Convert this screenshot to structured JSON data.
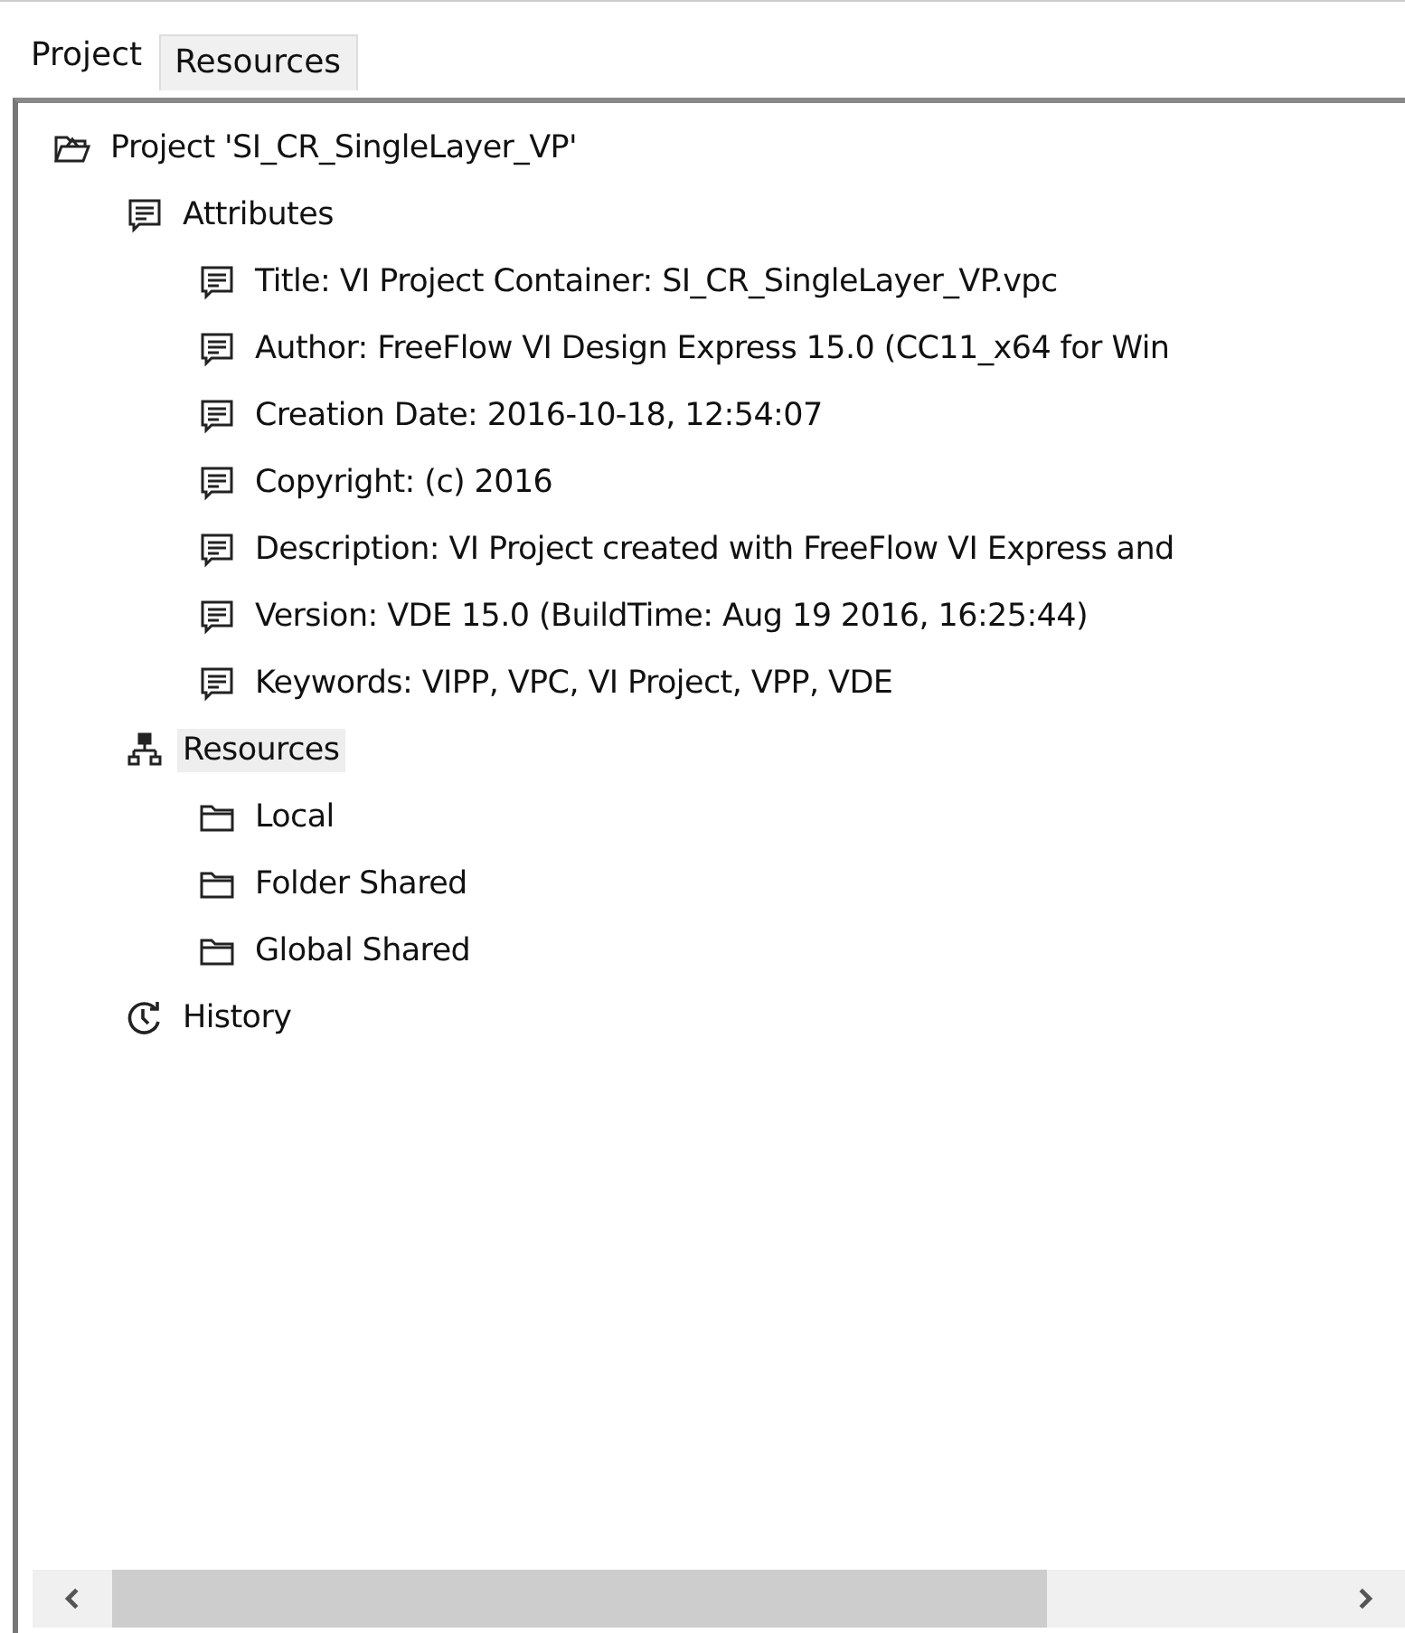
{
  "tabs": [
    {
      "label": "Project",
      "selected": true
    },
    {
      "label": "Resources",
      "selected": false
    }
  ],
  "tree": [
    {
      "label": "Project 'SI_CR_SingleLayer_VP'",
      "kind": "project",
      "selected": false,
      "children": [
        {
          "label": "Attributes",
          "kind": "attribute",
          "selected": false,
          "children": [
            {
              "label": "Title: VI Project Container: SI_CR_SingleLayer_VP.vpc",
              "kind": "attribute",
              "selected": false
            },
            {
              "label": "Author: FreeFlow VI Design Express 15.0 (CC11_x64 for Win",
              "kind": "attribute",
              "selected": false
            },
            {
              "label": "Creation Date: 2016-10-18, 12:54:07",
              "kind": "attribute",
              "selected": false
            },
            {
              "label": "Copyright: (c) 2016",
              "kind": "attribute",
              "selected": false
            },
            {
              "label": "Description: VI Project created with FreeFlow VI Express and",
              "kind": "attribute",
              "selected": false
            },
            {
              "label": "Version: VDE 15.0 (BuildTime: Aug 19 2016, 16:25:44)",
              "kind": "attribute",
              "selected": false
            },
            {
              "label": "Keywords: VIPP, VPC, VI Project, VPP, VDE",
              "kind": "attribute",
              "selected": false
            }
          ]
        },
        {
          "label": "Resources",
          "kind": "network",
          "selected": true,
          "children": [
            {
              "label": "Local",
              "kind": "folder",
              "selected": false
            },
            {
              "label": "Folder Shared",
              "kind": "folder",
              "selected": false
            },
            {
              "label": "Global Shared",
              "kind": "folder",
              "selected": false
            }
          ]
        },
        {
          "label": "History",
          "kind": "history",
          "selected": false
        }
      ]
    }
  ]
}
